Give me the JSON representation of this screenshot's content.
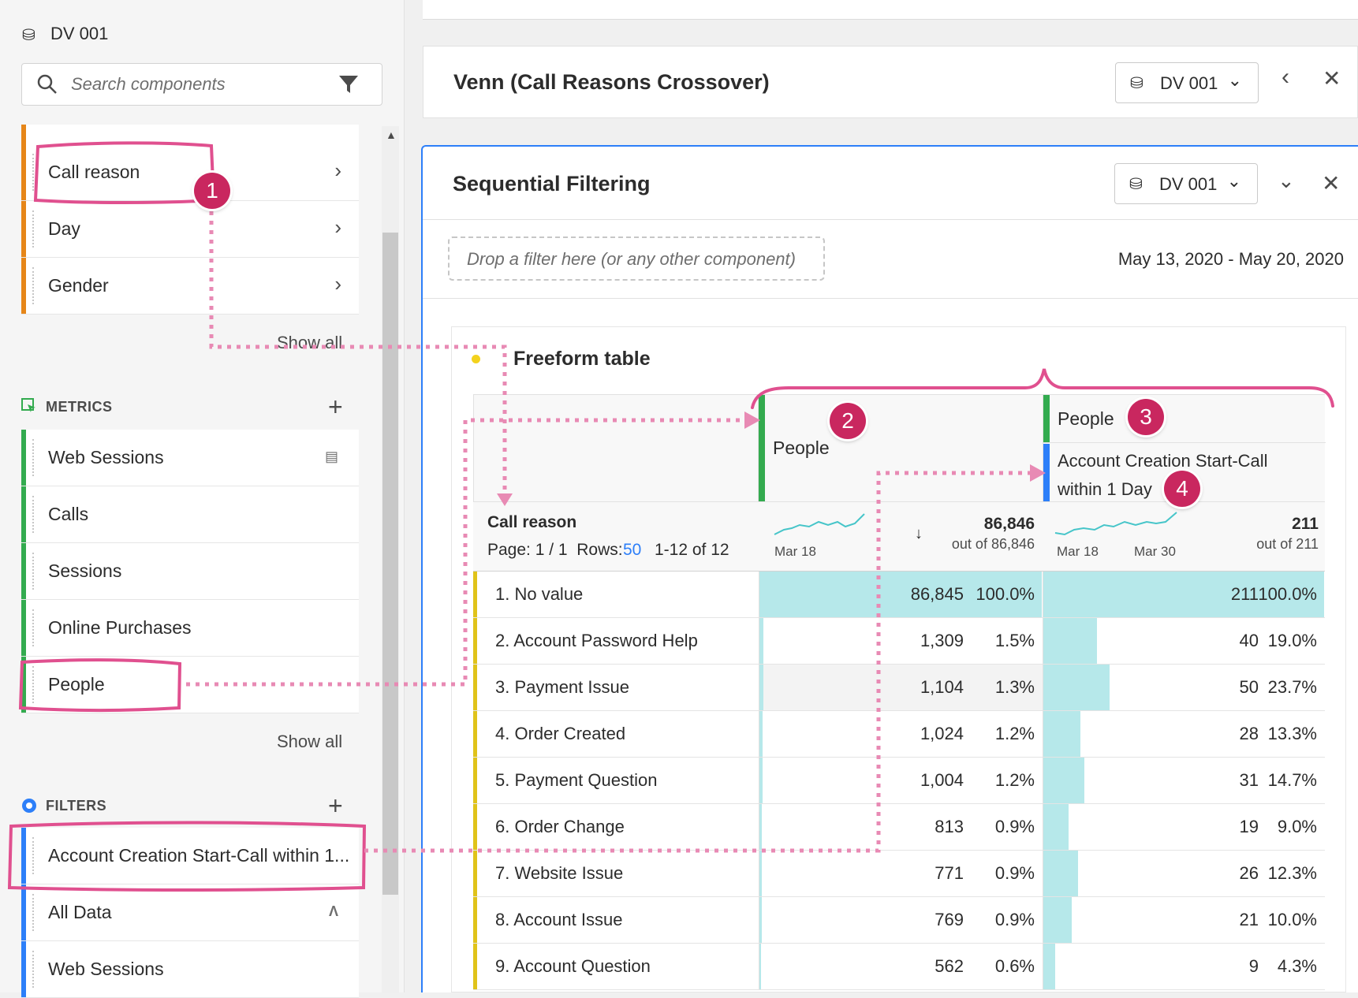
{
  "rail": {
    "datasource": "DV 001",
    "search_placeholder": "Search components",
    "dimensions": [
      {
        "label": "Call reason"
      },
      {
        "label": "Day"
      },
      {
        "label": "Gender"
      }
    ],
    "dimensions_show_all": "Show all",
    "metrics_title": "METRICS",
    "metrics": [
      {
        "label": "Web Sessions"
      },
      {
        "label": "Calls"
      },
      {
        "label": "Sessions"
      },
      {
        "label": "Online Purchases"
      },
      {
        "label": "People"
      }
    ],
    "metrics_show_all": "Show all",
    "filters_title": "FILTERS",
    "filters": [
      {
        "label": "Account Creation Start-Call within 1..."
      },
      {
        "label": "All Data"
      },
      {
        "label": "Web Sessions"
      }
    ]
  },
  "panel_venn": {
    "title": "Venn (Call Reasons Crossover)",
    "datasource": "DV 001"
  },
  "panel_seq": {
    "title": "Sequential Filtering",
    "datasource": "DV 001",
    "dropzone": "Drop a filter here (or any other component)",
    "date_range": "May 13, 2020 - May 20, 2020"
  },
  "table": {
    "title": "Freeform table",
    "col1_header": "People",
    "col2_header": "People",
    "col2_filter": "Account Creation Start-Call within 1 Day",
    "dim_header": "Call reason",
    "page_label": "Page: 1 / 1  Rows:",
    "rows_value": "50",
    "range_label": "1-12 of 12",
    "col1_total": "86,846",
    "col1_out_of": "out of 86,846",
    "col1_spark_date": "Mar 18",
    "col2_total": "211",
    "col2_out_of": "out of 211",
    "col2_spark_date1": "Mar 18",
    "col2_spark_date2": "Mar 30",
    "rows": [
      {
        "name": "1. No value",
        "v1": "86,845",
        "p1": "100.0%",
        "f1": 1.0,
        "v2": "211",
        "p2": "100.0%",
        "f2": 1.0
      },
      {
        "name": "2. Account Password Help",
        "v1": "1,309",
        "p1": "1.5%",
        "f1": 0.015,
        "v2": "40",
        "p2": "19.0%",
        "f2": 0.19
      },
      {
        "name": "3. Payment Issue",
        "v1": "1,104",
        "p1": "1.3%",
        "f1": 0.013,
        "v2": "50",
        "p2": "23.7%",
        "f2": 0.237
      },
      {
        "name": "4. Order Created",
        "v1": "1,024",
        "p1": "1.2%",
        "f1": 0.012,
        "v2": "28",
        "p2": "13.3%",
        "f2": 0.133
      },
      {
        "name": "5. Payment Question",
        "v1": "1,004",
        "p1": "1.2%",
        "f1": 0.012,
        "v2": "31",
        "p2": "14.7%",
        "f2": 0.147
      },
      {
        "name": "6. Order Change",
        "v1": "813",
        "p1": "0.9%",
        "f1": 0.009,
        "v2": "19",
        "p2": "9.0%",
        "f2": 0.09
      },
      {
        "name": "7. Website Issue",
        "v1": "771",
        "p1": "0.9%",
        "f1": 0.009,
        "v2": "26",
        "p2": "12.3%",
        "f2": 0.123
      },
      {
        "name": "8. Account Issue",
        "v1": "769",
        "p1": "0.9%",
        "f1": 0.009,
        "v2": "21",
        "p2": "10.0%",
        "f2": 0.1
      },
      {
        "name": "9. Account Question",
        "v1": "562",
        "p1": "0.6%",
        "f1": 0.006,
        "v2": "9",
        "p2": "4.3%",
        "f2": 0.043
      }
    ]
  },
  "callouts": [
    "1",
    "2",
    "3",
    "4"
  ],
  "colors": {
    "accent_pink": "#e0508f",
    "callout": "#c9275f",
    "fill": "#b6e8ea",
    "dim_orange": "#e68619",
    "metric_green": "#33ab4f",
    "filter_blue": "#2d7ff9",
    "row_yellow": "#e0c31a"
  }
}
